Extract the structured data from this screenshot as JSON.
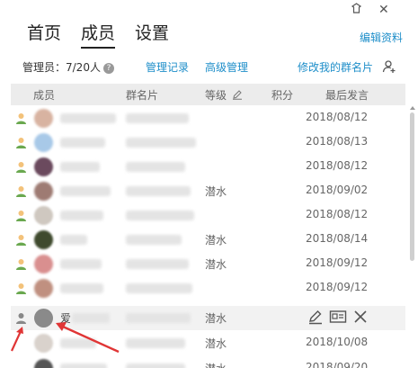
{
  "window": {
    "skin_icon": "skin-icon",
    "close_glyph": "✕"
  },
  "tabs": [
    {
      "label": "首页"
    },
    {
      "label": "成员"
    },
    {
      "label": "设置"
    }
  ],
  "edit_profile": "编辑资料",
  "admin_info": "管理员：7/20人",
  "links": {
    "manage_log": "管理记录",
    "advanced": "高级管理",
    "modify_card": "修改我的群名片"
  },
  "columns": {
    "member": "成员",
    "card": "群名片",
    "level": "等级",
    "points": "积分",
    "last_post": "最后发言"
  },
  "rows": [
    {
      "level": "",
      "last_post": "2018/08/12"
    },
    {
      "level": "",
      "last_post": "2018/08/13"
    },
    {
      "level": "",
      "last_post": "2018/08/12"
    },
    {
      "level": "潜水",
      "last_post": "2018/09/02"
    },
    {
      "level": "",
      "last_post": "2018/08/12"
    },
    {
      "level": "潜水",
      "last_post": "2018/08/14"
    },
    {
      "level": "潜水",
      "last_post": "2018/09/12"
    },
    {
      "level": "",
      "last_post": "2018/09/12"
    },
    {
      "level": "潜水",
      "last_post": ""
    },
    {
      "level": "潜水",
      "last_post": "2018/10/08"
    },
    {
      "level": "潜水",
      "last_post": "2018/09/20"
    }
  ],
  "hover_row": {
    "name_partial": "爱"
  },
  "colors": {
    "accent": "#1e8ec9",
    "arrow": "#e03535"
  }
}
